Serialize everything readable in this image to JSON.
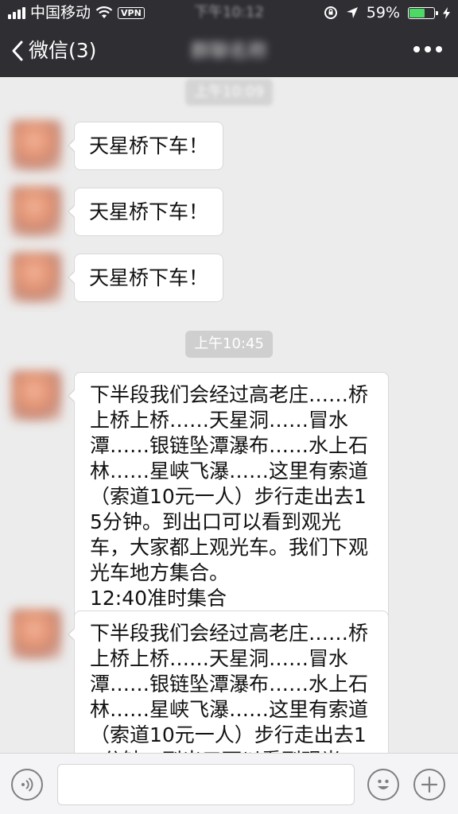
{
  "status_bar": {
    "carrier": "中国移动",
    "vpn": "VPN",
    "time": "下午10:12",
    "battery_percent": "59%",
    "battery_level": 0.59,
    "battery_color": "#4cd964"
  },
  "nav": {
    "back_label": "微信(3)",
    "chat_title": "群聊名称"
  },
  "chat": {
    "timestamp_1": "上午10:09",
    "timestamp_2": "上午10:45",
    "messages_short": [
      "天星桥下车！",
      "天星桥下车！",
      "天星桥下车！"
    ],
    "message_long_1": "下半段我们会经过高老庄……桥上桥上桥……天星洞……冒水潭……银链坠潭瀑布……水上石林……星峡飞瀑……这里有索道（索道10元一人）步行走出去15分钟。到出口可以看到观光车，大家都上观光车。我们下观光车地方集合。\n12:40准时集合",
    "message_long_2": "下半段我们会经过高老庄……桥上桥上桥……天星洞……冒水潭……银链坠潭瀑布……水上石林……星峡飞瀑……这里有索道（索道10元一人）步行走出去15分钟。到出口可以看到观光车，大家都上观光车。"
  },
  "input_bar": {
    "voice_icon": "voice-icon",
    "emoji_icon": "emoji-icon",
    "add_icon": "plus-icon"
  },
  "colors": {
    "header_bg": "#2e2e33",
    "chat_bg": "#ececec",
    "bubble_bg": "#ffffff"
  }
}
